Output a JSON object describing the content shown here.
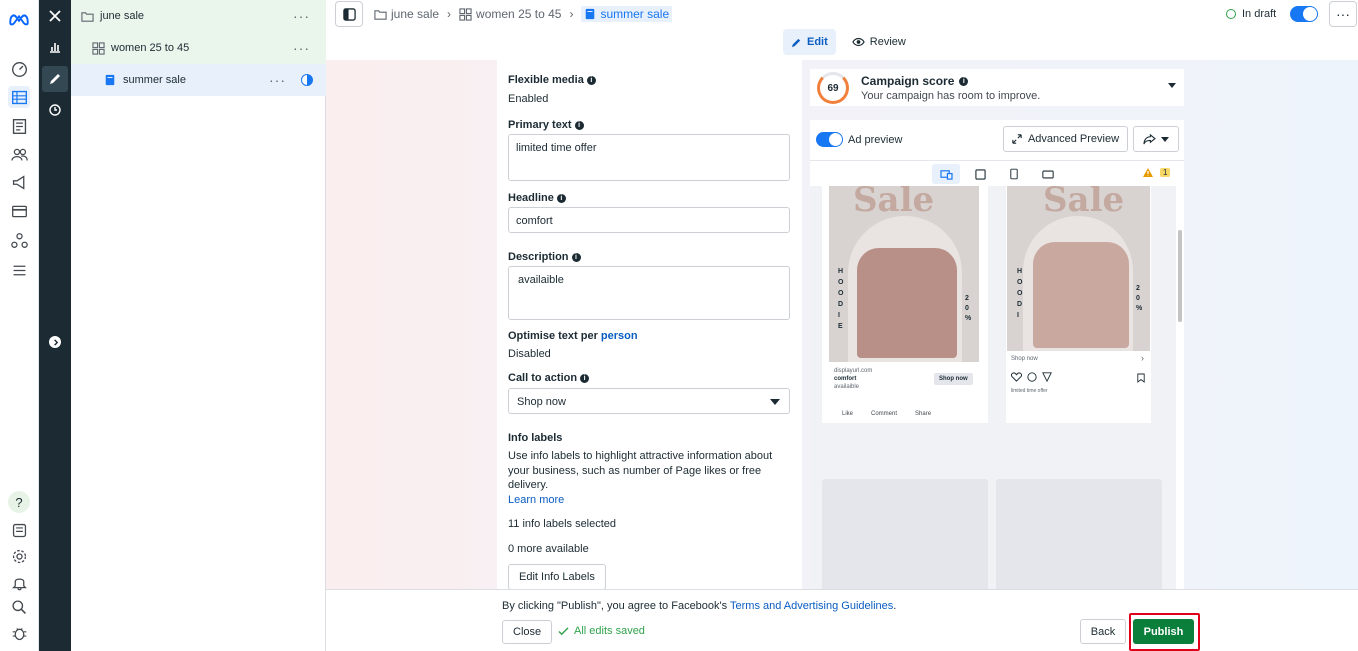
{
  "colors": {
    "accent": "#1877f2",
    "publish": "#0a7e3b",
    "highlight": "#e0001b",
    "success": "#31a24c"
  },
  "rail": {
    "icons": [
      "meta-logo-icon",
      "dashboard-icon",
      "campaigns-table-icon",
      "pages-icon",
      "audiences-icon",
      "ads-icon",
      "billing-icon",
      "events-icon",
      "menu-icon",
      "help-icon",
      "reports-icon",
      "settings-icon",
      "notifications-icon",
      "search-icon",
      "bug-icon"
    ],
    "help_glyph": "?"
  },
  "tree": {
    "items": [
      {
        "label": "june sale",
        "type": "campaign"
      },
      {
        "label": "women 25 to 45",
        "type": "adset"
      },
      {
        "label": "summer sale",
        "type": "ad"
      }
    ]
  },
  "breadcrumb": {
    "items": [
      "june sale",
      "women 25 to 45",
      "summer sale"
    ]
  },
  "status": {
    "label": "In draft"
  },
  "modes": {
    "edit": "Edit",
    "review": "Review"
  },
  "form": {
    "flexible_media": {
      "label": "Flexible media",
      "value": "Enabled"
    },
    "primary_text": {
      "label": "Primary text",
      "value": "limited time offer"
    },
    "headline": {
      "label": "Headline",
      "value": "comfort"
    },
    "description": {
      "label": "Description",
      "value": "availaible"
    },
    "optimise": {
      "label": "Optimise text per",
      "label_link": "person",
      "value": "Disabled"
    },
    "cta": {
      "label": "Call to action",
      "value": "Shop now"
    },
    "info_labels": {
      "label": "Info labels",
      "help": "Use info labels to highlight attractive information about your business, such as number of Page likes or free delivery.",
      "learn_more": "Learn more",
      "selected": "11 info labels selected",
      "available": "0 more available",
      "edit_button": "Edit Info Labels"
    }
  },
  "score": {
    "value": "69",
    "title": "Campaign score",
    "subtitle": "Your campaign has room to improve."
  },
  "preview": {
    "toggle_label": "Ad preview",
    "advanced": "Advanced Preview",
    "warning_count": "1",
    "sale_word": "Sale",
    "vertical_text": [
      "H",
      "O",
      "O",
      "D",
      "I",
      "E"
    ],
    "percent_text": [
      "2",
      "0",
      "%"
    ],
    "feed_card": {
      "domain": "displayurl.com",
      "headline": "comfort",
      "description": "availaible",
      "cta": "Shop now",
      "actions": [
        "Like",
        "Comment",
        "Share"
      ]
    },
    "insta_card": {
      "cta": "Shop now",
      "caption": "limited time offer"
    }
  },
  "footer": {
    "terms_prefix": "By clicking \"Publish\", you agree to Facebook's ",
    "terms_link": "Terms and Advertising Guidelines",
    "terms_suffix": ".",
    "close": "Close",
    "saved": "All edits saved",
    "back": "Back",
    "publish": "Publish"
  }
}
